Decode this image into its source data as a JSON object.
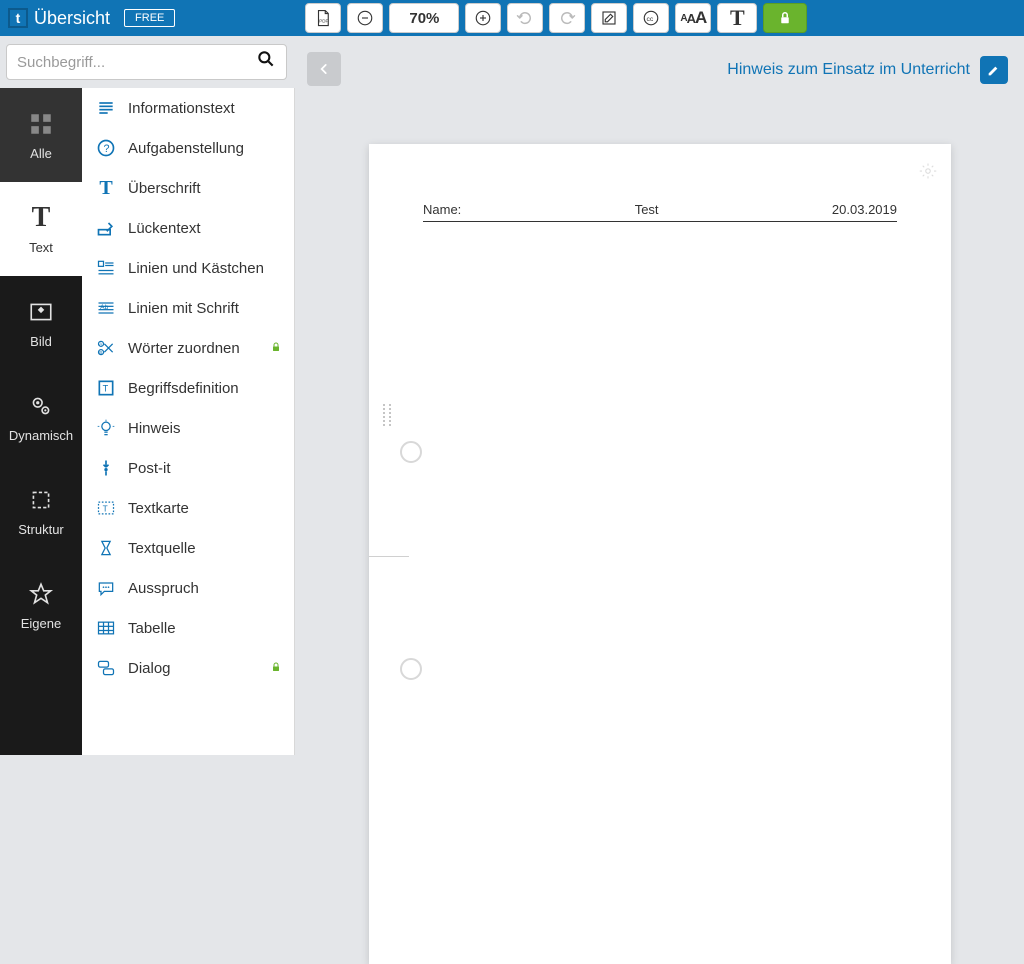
{
  "app": {
    "title": "Übersicht",
    "badge": "FREE"
  },
  "toolbar": {
    "pdf": "PDF",
    "zoom": "70%",
    "aaa": "AAA"
  },
  "search": {
    "placeholder": "Suchbegriff..."
  },
  "categories": [
    {
      "label": "Alle"
    },
    {
      "label": "Text"
    },
    {
      "label": "Bild"
    },
    {
      "label": "Dynamisch"
    },
    {
      "label": "Struktur"
    },
    {
      "label": "Eigene"
    }
  ],
  "modules": [
    {
      "label": "Informationstext",
      "icon": "info-lines"
    },
    {
      "label": "Aufgabenstellung",
      "icon": "question"
    },
    {
      "label": "Überschrift",
      "icon": "heading"
    },
    {
      "label": "Lückentext",
      "icon": "gap-text"
    },
    {
      "label": "Linien und Kästchen",
      "icon": "lines-boxes"
    },
    {
      "label": "Linien mit Schrift",
      "icon": "lines-text"
    },
    {
      "label": "Wörter zuordnen",
      "icon": "word-match",
      "locked": true
    },
    {
      "label": "Begriffsdefinition",
      "icon": "definition"
    },
    {
      "label": "Hinweis",
      "icon": "hint"
    },
    {
      "label": "Post-it",
      "icon": "postit"
    },
    {
      "label": "Textkarte",
      "icon": "textcard"
    },
    {
      "label": "Textquelle",
      "icon": "hourglass"
    },
    {
      "label": "Ausspruch",
      "icon": "quote"
    },
    {
      "label": "Tabelle",
      "icon": "table"
    },
    {
      "label": "Dialog",
      "icon": "dialog",
      "locked": true
    }
  ],
  "hint": {
    "text": "Hinweis zum Einsatz im Unterricht"
  },
  "document": {
    "name_label": "Name:",
    "center": "Test",
    "date": "20.03.2019"
  }
}
